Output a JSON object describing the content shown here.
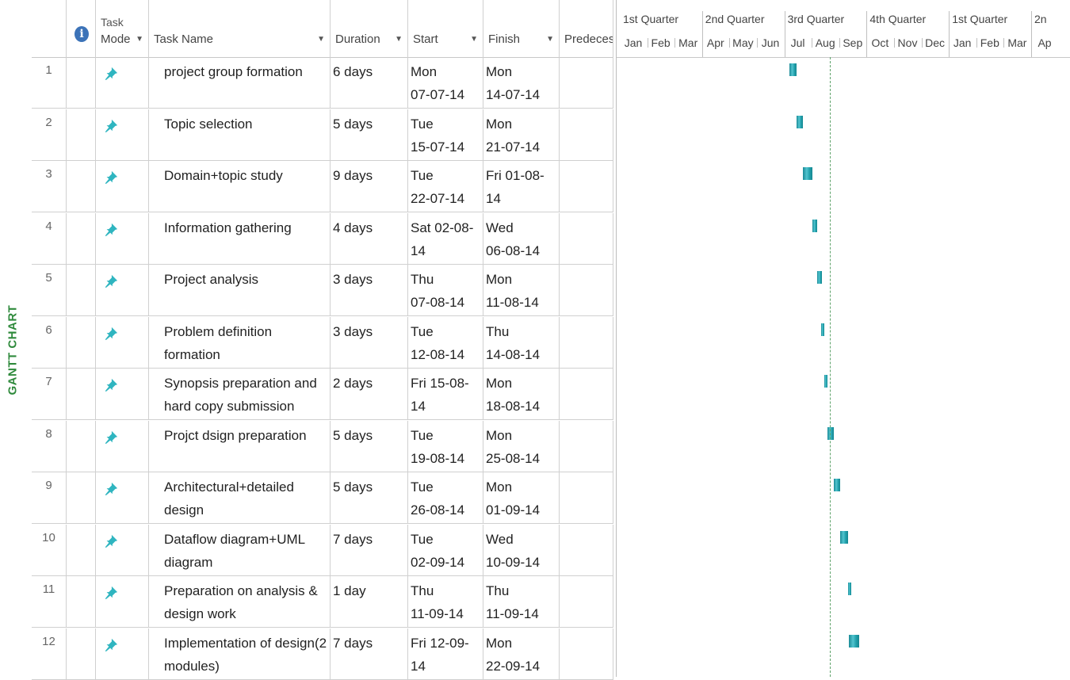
{
  "side_label": "GANTT CHART",
  "columns": {
    "mode_line1": "Task",
    "mode_line2": "Mode",
    "task_name": "Task Name",
    "duration": "Duration",
    "start": "Start",
    "finish": "Finish",
    "predecessors": "Predecess",
    "info_glyph": "i"
  },
  "timescale": {
    "quarters": [
      "1st Quarter",
      "2nd Quarter",
      "3rd Quarter",
      "4th Quarter",
      "1st Quarter",
      "2n"
    ],
    "months": [
      "Jan",
      "Feb",
      "Mar",
      "Apr",
      "May",
      "Jun",
      "Jul",
      "Aug",
      "Sep",
      "Oct",
      "Nov",
      "Dec",
      "Jan",
      "Feb",
      "Mar",
      "Ap"
    ],
    "status_date": "2014-08-21"
  },
  "tasks": [
    {
      "id": "1",
      "name_1": "project group formation",
      "name_2": "",
      "duration": "6 days",
      "start_1": "Mon",
      "start_2": "07-07-14",
      "finish_1": "Mon",
      "finish_2": "14-07-14",
      "bar_start": "2014-07-07",
      "bar_end": "2014-07-14"
    },
    {
      "id": "2",
      "name_1": "Topic selection",
      "name_2": "",
      "duration": "5 days",
      "start_1": "Tue",
      "start_2": "15-07-14",
      "finish_1": "Mon",
      "finish_2": "21-07-14",
      "bar_start": "2014-07-15",
      "bar_end": "2014-07-21"
    },
    {
      "id": "3",
      "name_1": "Domain+topic study",
      "name_2": "",
      "duration": "9 days",
      "start_1": "Tue",
      "start_2": "22-07-14",
      "finish_1": "Fri 01-08-14",
      "finish_2": "",
      "bar_start": "2014-07-22",
      "bar_end": "2014-08-01"
    },
    {
      "id": "4",
      "name_1": "Information gathering",
      "name_2": "",
      "duration": "4 days",
      "start_1": "Sat 02-08-14",
      "start_2": "",
      "finish_1": "Wed",
      "finish_2": "06-08-14",
      "bar_start": "2014-08-02",
      "bar_end": "2014-08-06"
    },
    {
      "id": "5",
      "name_1": "Project analysis",
      "name_2": "",
      "duration": "3 days",
      "start_1": "Thu",
      "start_2": "07-08-14",
      "finish_1": "Mon",
      "finish_2": "11-08-14",
      "bar_start": "2014-08-07",
      "bar_end": "2014-08-11"
    },
    {
      "id": "6",
      "name_1": "Problem definition",
      "name_2": "formation",
      "duration": "3 days",
      "start_1": "Tue",
      "start_2": "12-08-14",
      "finish_1": "Thu",
      "finish_2": "14-08-14",
      "bar_start": "2014-08-12",
      "bar_end": "2014-08-14"
    },
    {
      "id": "7",
      "name_1": "Synopsis preparation and",
      "name_2": "hard copy submission",
      "duration": "2 days",
      "start_1": "Fri 15-08-14",
      "start_2": "",
      "finish_1": "Mon",
      "finish_2": "18-08-14",
      "bar_start": "2014-08-15",
      "bar_end": "2014-08-18"
    },
    {
      "id": "8",
      "name_1": "Projct dsign preparation",
      "name_2": "",
      "duration": "5 days",
      "start_1": "Tue",
      "start_2": "19-08-14",
      "finish_1": "Mon",
      "finish_2": "25-08-14",
      "bar_start": "2014-08-19",
      "bar_end": "2014-08-25"
    },
    {
      "id": "9",
      "name_1": "Architectural+detailed",
      "name_2": "design",
      "duration": "5 days",
      "start_1": "Tue",
      "start_2": "26-08-14",
      "finish_1": "Mon",
      "finish_2": "01-09-14",
      "bar_start": "2014-08-26",
      "bar_end": "2014-09-01"
    },
    {
      "id": "10",
      "name_1": "Dataflow diagram+UML",
      "name_2": "diagram",
      "duration": "7 days",
      "start_1": "Tue",
      "start_2": "02-09-14",
      "finish_1": "Wed",
      "finish_2": "10-09-14",
      "bar_start": "2014-09-02",
      "bar_end": "2014-09-10"
    },
    {
      "id": "11",
      "name_1": "Preparation on analysis &",
      "name_2": "design work",
      "duration": "1 day",
      "start_1": "Thu",
      "start_2": "11-09-14",
      "finish_1": "Thu",
      "finish_2": "11-09-14",
      "bar_start": "2014-09-11",
      "bar_end": "2014-09-11"
    },
    {
      "id": "12",
      "name_1": "Implementation of design(2",
      "name_2": "modules)",
      "duration": "7 days",
      "start_1": "Fri 12-09-14",
      "start_2": "",
      "finish_1": "Mon",
      "finish_2": "22-09-14",
      "bar_start": "2014-09-12",
      "bar_end": "2014-09-22"
    }
  ],
  "colors": {
    "bar": "#21a0ab",
    "side_label": "#2f8a3c",
    "info_icon": "#3c73b8",
    "pin_icon": "#2fb5c0"
  }
}
